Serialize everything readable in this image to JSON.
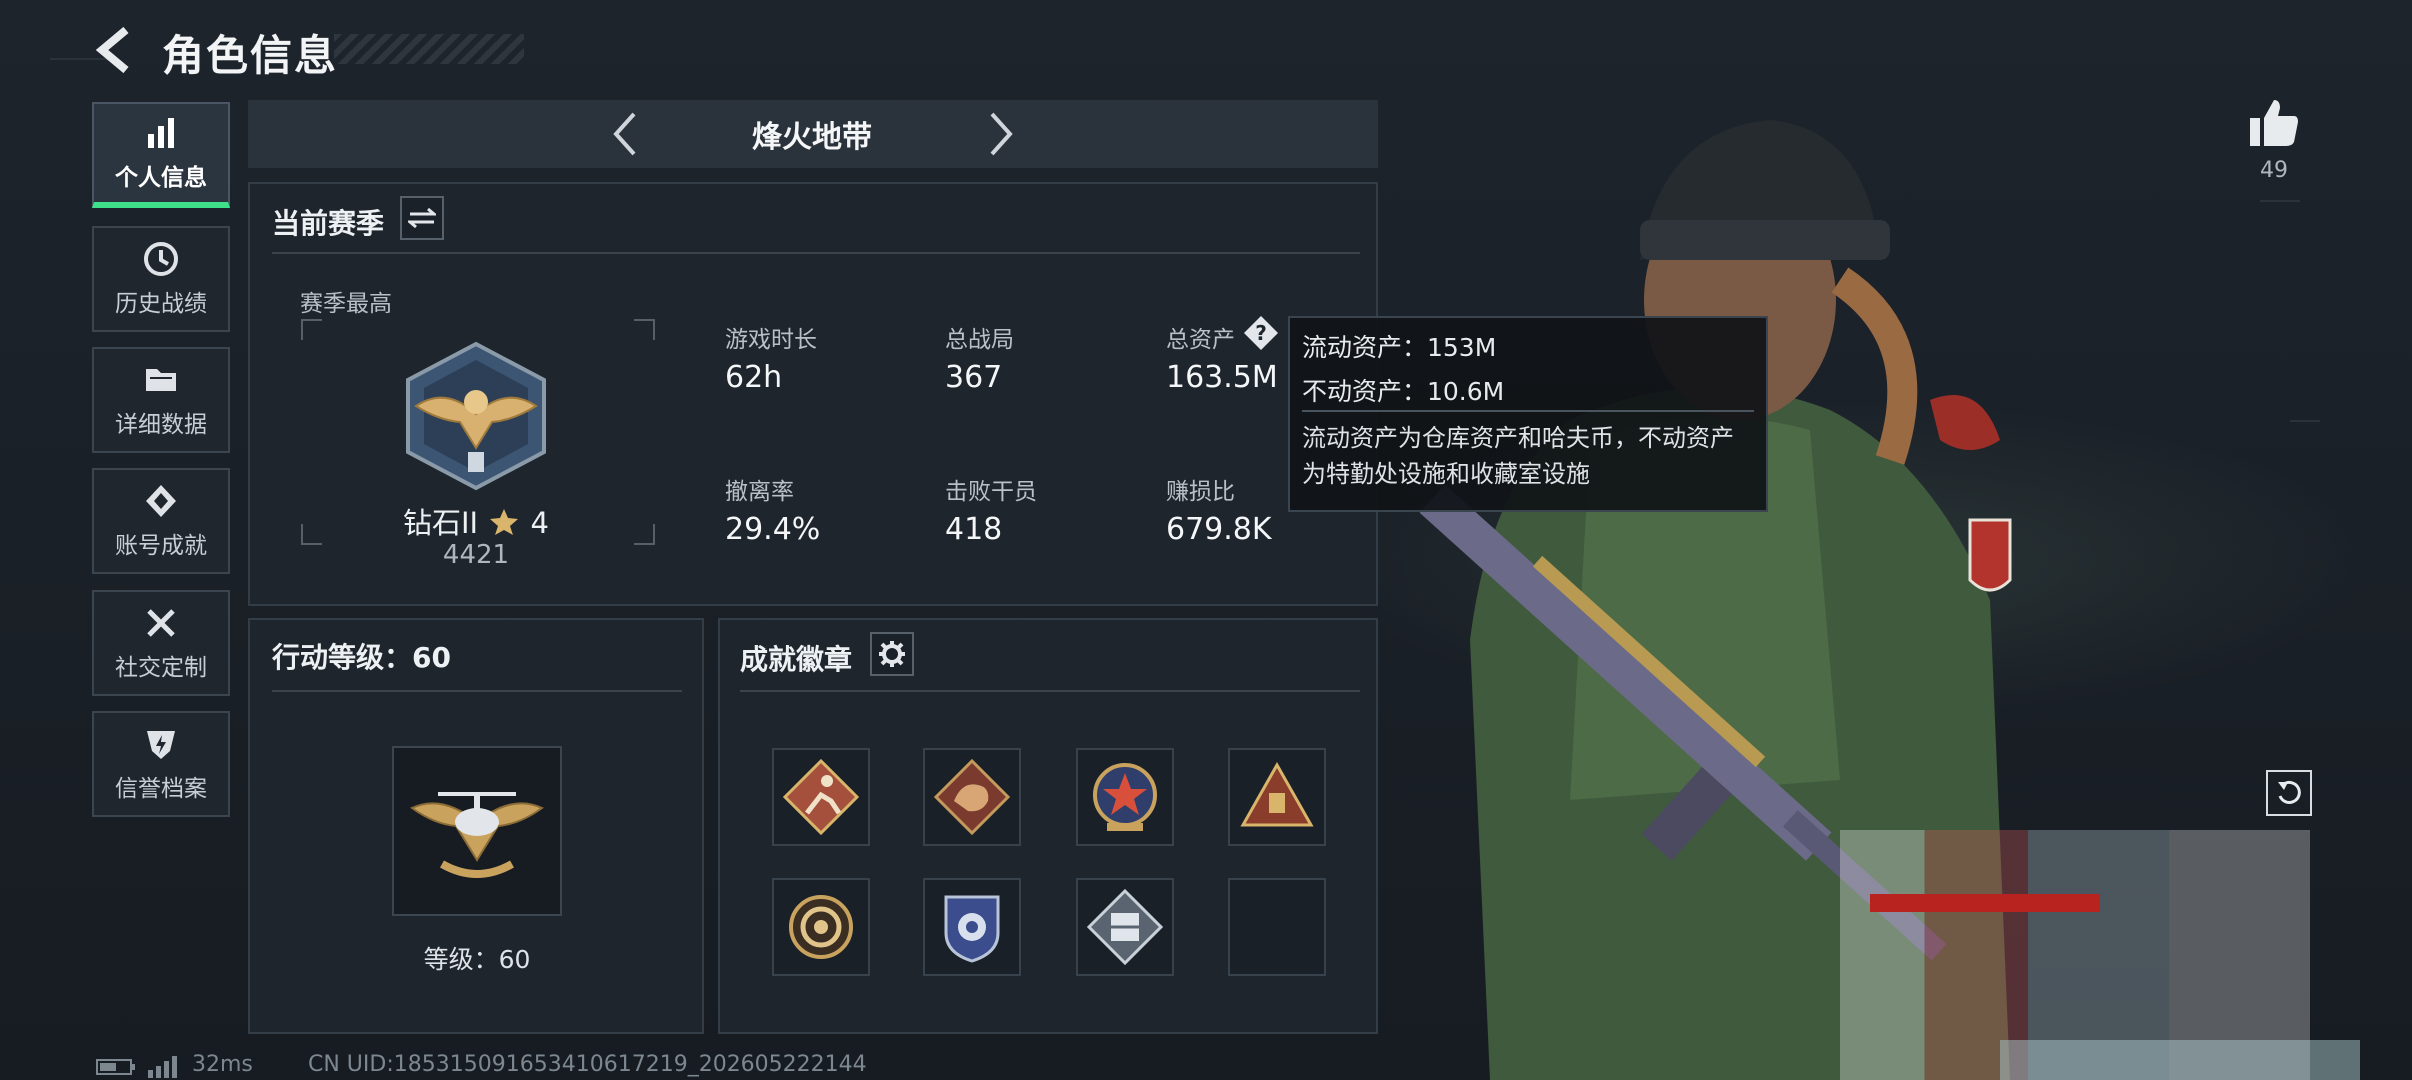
{
  "header": {
    "title": "角色信息"
  },
  "sidebar": {
    "items": [
      {
        "label": "个人信息",
        "icon": "bar-chart-icon",
        "active": true
      },
      {
        "label": "历史战绩",
        "icon": "history-icon",
        "active": false
      },
      {
        "label": "详细数据",
        "icon": "folder-icon",
        "active": false
      },
      {
        "label": "账号成就",
        "icon": "achievement-icon",
        "active": false
      },
      {
        "label": "社交定制",
        "icon": "tools-icon",
        "active": false
      },
      {
        "label": "信誉档案",
        "icon": "shield-icon",
        "active": false
      }
    ]
  },
  "mode_tabs": {
    "current": "烽火地带"
  },
  "season": {
    "title": "当前赛季",
    "best_label": "赛季最高",
    "rank_name": "钻石II",
    "rank_stars": "4",
    "rank_points": "4421",
    "stats": [
      {
        "label": "游戏时长",
        "value": "62h"
      },
      {
        "label": "总战局",
        "value": "367"
      },
      {
        "label": "总资产",
        "value": "163.5M"
      },
      {
        "label": "撤离率",
        "value": "29.4%"
      },
      {
        "label": "击败干员",
        "value": "418"
      },
      {
        "label": "赚损比",
        "value": "679.8K"
      }
    ]
  },
  "tooltip": {
    "liquid": "流动资产：153M",
    "fixed": "不动资产：10.6M",
    "desc1": "流动资产为仓库资产和哈夫币，不动资产",
    "desc2": "为特勤处设施和收藏室设施"
  },
  "action_level": {
    "title": "行动等级：60",
    "level_text": "等级：60"
  },
  "badges": {
    "title": "成就徽章"
  },
  "likes": {
    "count": "49"
  },
  "footer": {
    "ping": "32ms",
    "uid": "CN UID:185315091653410617219_202605222144"
  },
  "colors": {
    "accent_green": "#3ee08a",
    "panel_bg": "#1e252d",
    "background": "#1a2027"
  }
}
